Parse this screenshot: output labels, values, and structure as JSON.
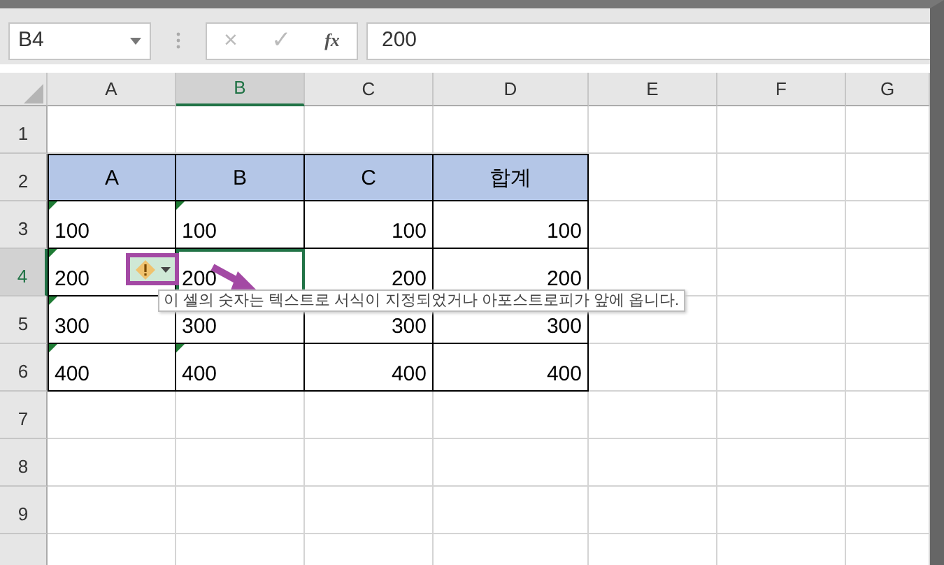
{
  "name_box": {
    "value": "B4"
  },
  "formula_bar": {
    "cancel": "×",
    "enter": "✓",
    "function": "fx",
    "value": "200"
  },
  "columns": [
    {
      "label": "A",
      "selected": false
    },
    {
      "label": "B",
      "selected": true
    },
    {
      "label": "C",
      "selected": false
    },
    {
      "label": "D",
      "selected": false
    },
    {
      "label": "E",
      "selected": false
    },
    {
      "label": "F",
      "selected": false
    },
    {
      "label": "G",
      "selected": false
    }
  ],
  "rows": [
    {
      "number": "1",
      "selected": false,
      "cells": []
    },
    {
      "number": "2",
      "selected": false,
      "cells": [
        {
          "text": "A",
          "kind": "header",
          "flag": false,
          "selected": false
        },
        {
          "text": "B",
          "kind": "header",
          "flag": false,
          "selected": false
        },
        {
          "text": "C",
          "kind": "header",
          "flag": false,
          "selected": false
        },
        {
          "text": "합계",
          "kind": "header",
          "flag": false,
          "selected": false
        }
      ]
    },
    {
      "number": "3",
      "selected": false,
      "cells": [
        {
          "text": "100",
          "kind": "text",
          "flag": true,
          "selected": false
        },
        {
          "text": "100",
          "kind": "text",
          "flag": true,
          "selected": false
        },
        {
          "text": "100",
          "kind": "number",
          "flag": false,
          "selected": false
        },
        {
          "text": "100",
          "kind": "number",
          "flag": false,
          "selected": false
        }
      ]
    },
    {
      "number": "4",
      "selected": true,
      "cells": [
        {
          "text": "200",
          "kind": "text",
          "flag": true,
          "selected": false
        },
        {
          "text": "200",
          "kind": "text",
          "flag": false,
          "selected": true
        },
        {
          "text": "200",
          "kind": "number",
          "flag": false,
          "selected": false
        },
        {
          "text": "200",
          "kind": "number",
          "flag": false,
          "selected": false
        }
      ]
    },
    {
      "number": "5",
      "selected": false,
      "cells": [
        {
          "text": "300",
          "kind": "text",
          "flag": true,
          "selected": false
        },
        {
          "text": "300",
          "kind": "text",
          "flag": false,
          "selected": false
        },
        {
          "text": "300",
          "kind": "number",
          "flag": false,
          "selected": false
        },
        {
          "text": "300",
          "kind": "number",
          "flag": false,
          "selected": false
        }
      ]
    },
    {
      "number": "6",
      "selected": false,
      "cells": [
        {
          "text": "400",
          "kind": "text",
          "flag": true,
          "selected": false
        },
        {
          "text": "400",
          "kind": "text",
          "flag": true,
          "selected": false
        },
        {
          "text": "400",
          "kind": "number",
          "flag": false,
          "selected": false
        },
        {
          "text": "400",
          "kind": "number",
          "flag": false,
          "selected": false
        }
      ]
    },
    {
      "number": "7",
      "selected": false,
      "cells": []
    },
    {
      "number": "8",
      "selected": false,
      "cells": []
    },
    {
      "number": "9",
      "selected": false,
      "cells": []
    }
  ],
  "error_tooltip": {
    "text": "이 셀의 숫자는 텍스트로 서식이 지정되었거나 아포스트로피가 앞에 옵니다."
  }
}
